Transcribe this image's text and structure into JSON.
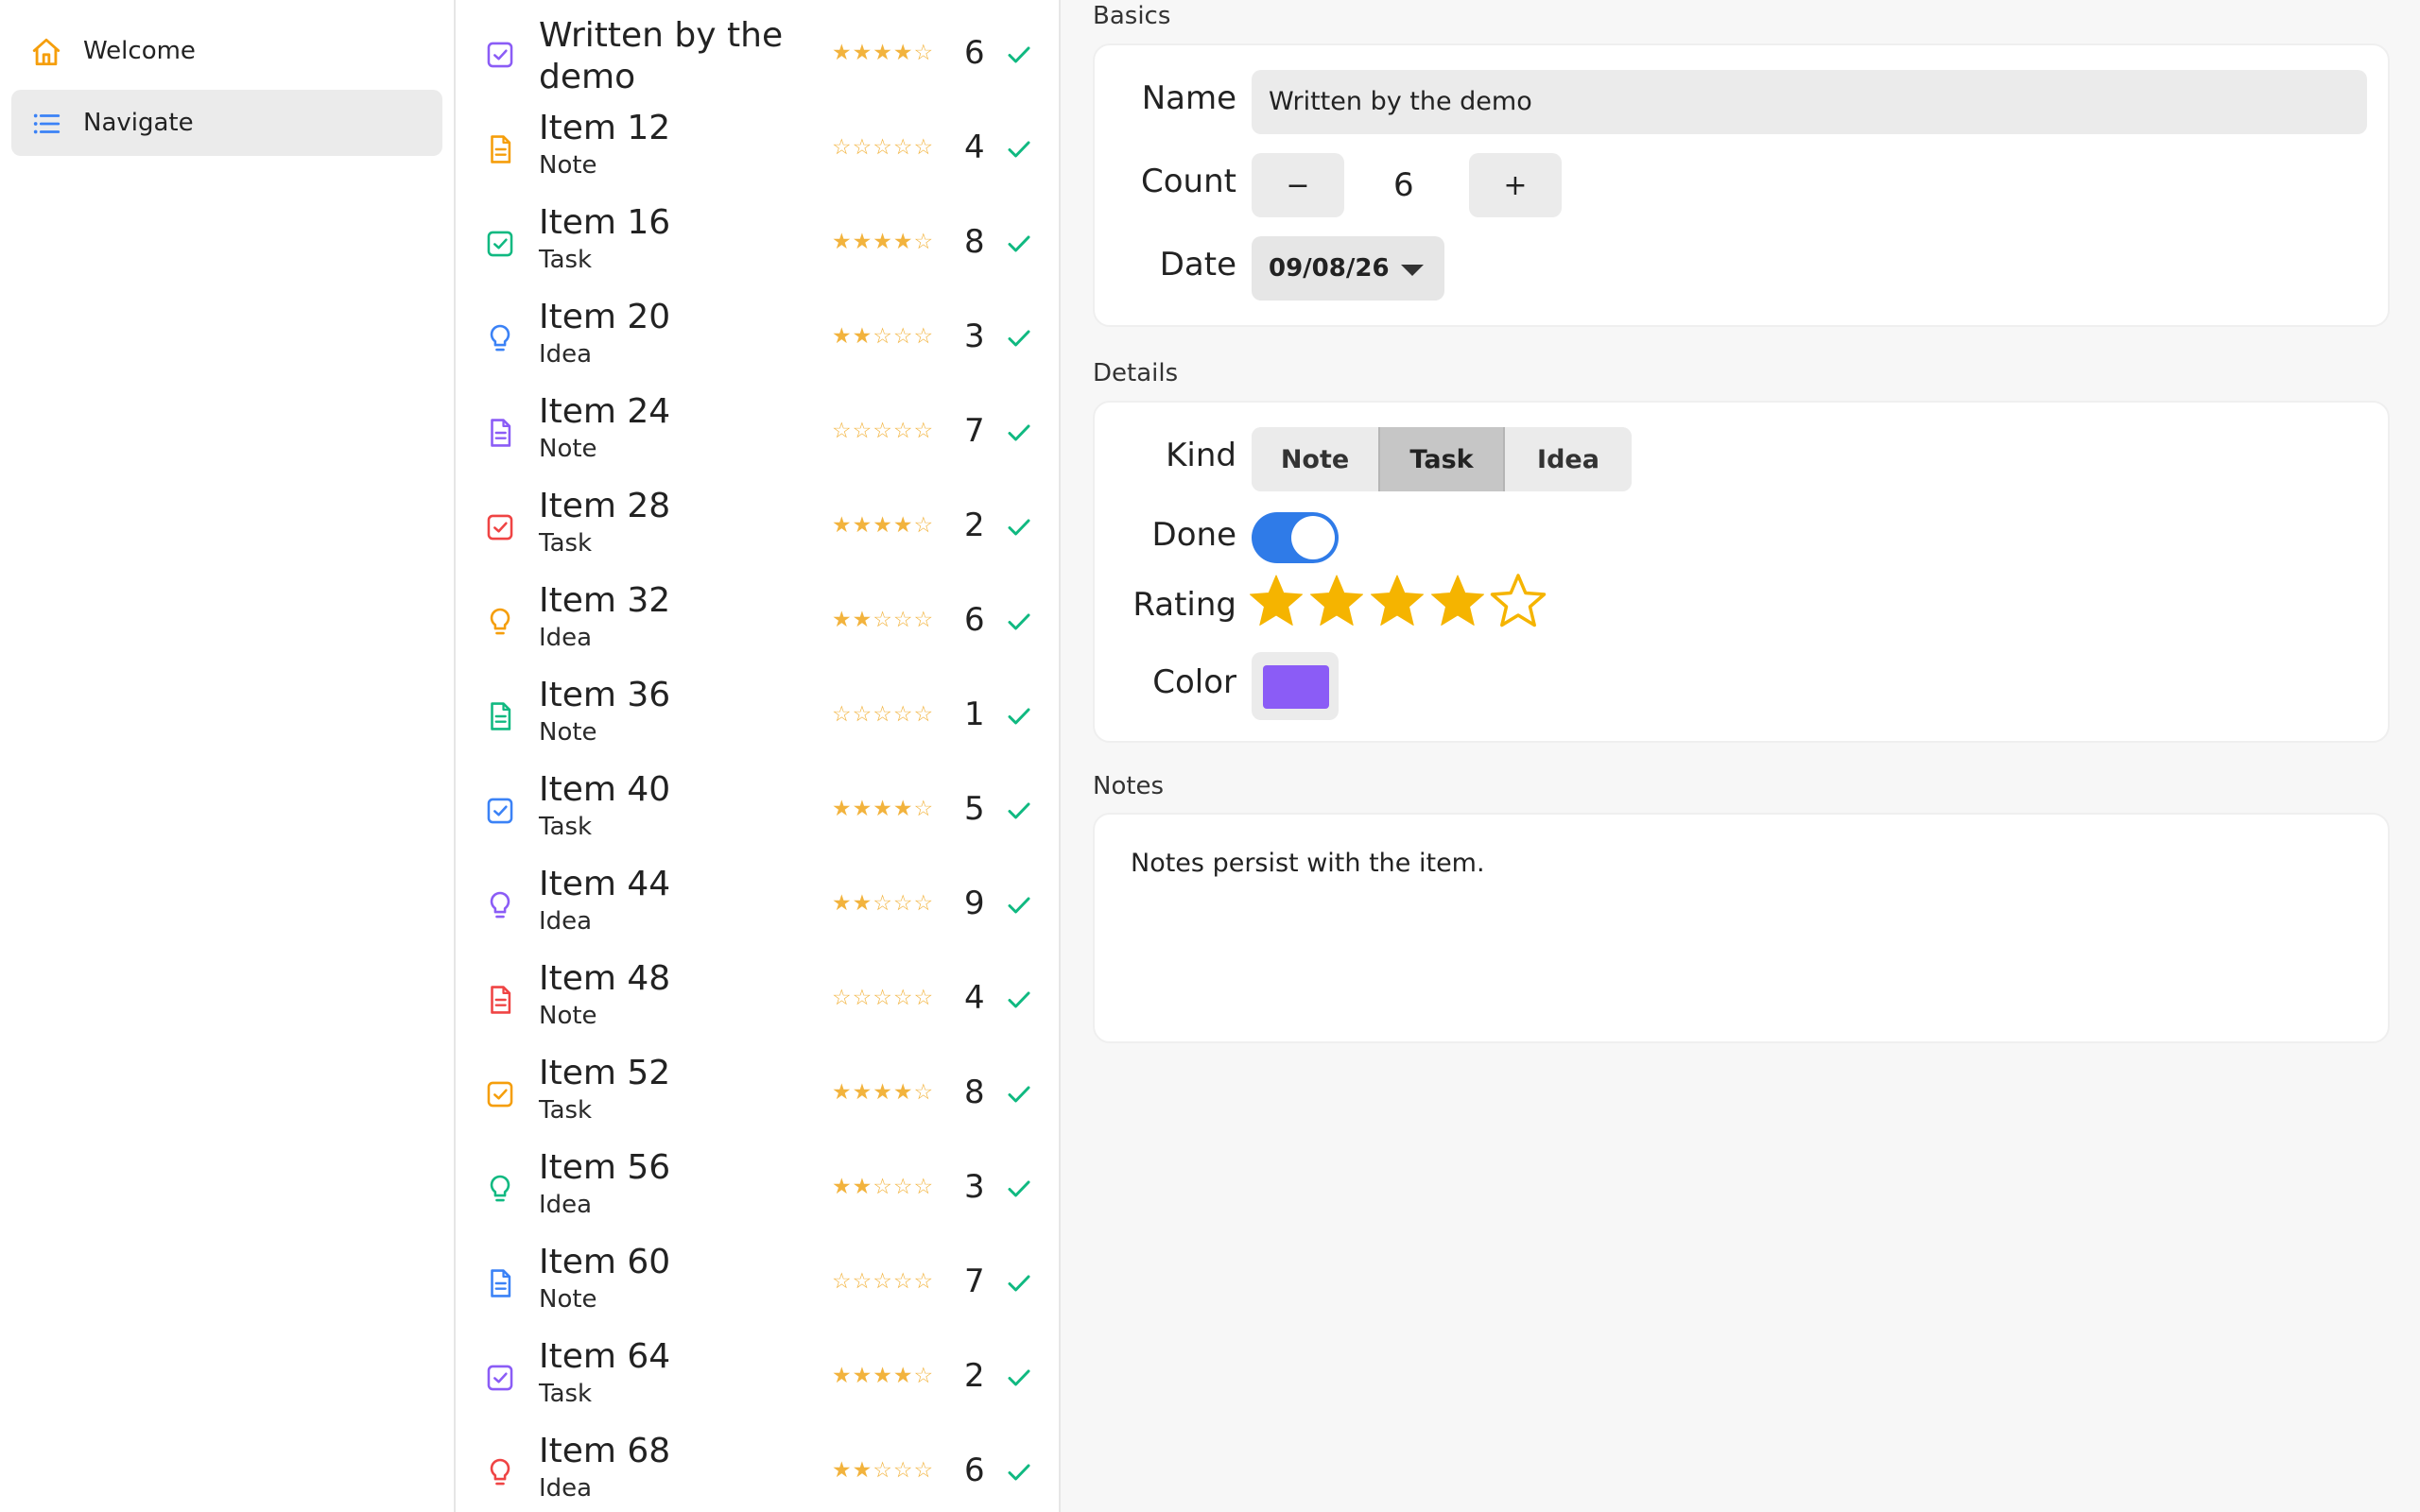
{
  "sidebar": {
    "items": [
      {
        "label": "Welcome",
        "icon": "home-icon"
      },
      {
        "label": "Navigate",
        "icon": "list-icon",
        "active": true
      }
    ]
  },
  "list": {
    "rows": [
      {
        "title": "Written by the demo",
        "subtitle": "",
        "kind": "task",
        "color": "#8b5cf6",
        "stars": "★★★★☆",
        "count": "6"
      },
      {
        "title": "Item 12",
        "subtitle": "Note",
        "kind": "note",
        "color": "#f59e0b",
        "stars": "☆☆☆☆☆",
        "count": "4"
      },
      {
        "title": "Item 16",
        "subtitle": "Task",
        "kind": "task",
        "color": "#10b981",
        "stars": "★★★★☆",
        "count": "8"
      },
      {
        "title": "Item 20",
        "subtitle": "Idea",
        "kind": "idea",
        "color": "#3b82f6",
        "stars": "★★☆☆☆",
        "count": "3"
      },
      {
        "title": "Item 24",
        "subtitle": "Note",
        "kind": "note",
        "color": "#8b5cf6",
        "stars": "☆☆☆☆☆",
        "count": "7"
      },
      {
        "title": "Item 28",
        "subtitle": "Task",
        "kind": "task",
        "color": "#ef4444",
        "stars": "★★★★☆",
        "count": "2"
      },
      {
        "title": "Item 32",
        "subtitle": "Idea",
        "kind": "idea",
        "color": "#f59e0b",
        "stars": "★★☆☆☆",
        "count": "6"
      },
      {
        "title": "Item 36",
        "subtitle": "Note",
        "kind": "note",
        "color": "#10b981",
        "stars": "☆☆☆☆☆",
        "count": "1"
      },
      {
        "title": "Item 40",
        "subtitle": "Task",
        "kind": "task",
        "color": "#3b82f6",
        "stars": "★★★★☆",
        "count": "5"
      },
      {
        "title": "Item 44",
        "subtitle": "Idea",
        "kind": "idea",
        "color": "#8b5cf6",
        "stars": "★★☆☆☆",
        "count": "9"
      },
      {
        "title": "Item 48",
        "subtitle": "Note",
        "kind": "note",
        "color": "#ef4444",
        "stars": "☆☆☆☆☆",
        "count": "4"
      },
      {
        "title": "Item 52",
        "subtitle": "Task",
        "kind": "task",
        "color": "#f59e0b",
        "stars": "★★★★☆",
        "count": "8"
      },
      {
        "title": "Item 56",
        "subtitle": "Idea",
        "kind": "idea",
        "color": "#10b981",
        "stars": "★★☆☆☆",
        "count": "3"
      },
      {
        "title": "Item 60",
        "subtitle": "Note",
        "kind": "note",
        "color": "#3b82f6",
        "stars": "☆☆☆☆☆",
        "count": "7"
      },
      {
        "title": "Item 64",
        "subtitle": "Task",
        "kind": "task",
        "color": "#8b5cf6",
        "stars": "★★★★☆",
        "count": "2"
      },
      {
        "title": "Item 68",
        "subtitle": "Idea",
        "kind": "idea",
        "color": "#ef4444",
        "stars": "★★☆☆☆",
        "count": "6"
      }
    ],
    "check_color": "#10b981"
  },
  "detail": {
    "basics": {
      "section_label": "Basics",
      "name_label": "Name",
      "name_value": "Written by the demo",
      "count_label": "Count",
      "count_value": "6",
      "minus_label": "−",
      "plus_label": "+",
      "date_label": "Date",
      "date_value": "09/08/26"
    },
    "details": {
      "section_label": "Details",
      "kind_label": "Kind",
      "kind_options": [
        "Note",
        "Task",
        "Idea"
      ],
      "kind_selected": "Task",
      "done_label": "Done",
      "done_value": true,
      "rating_label": "Rating",
      "rating_value": 4,
      "rating_max": 5,
      "color_label": "Color",
      "color_value": "#8b5cf6"
    },
    "notes": {
      "section_label": "Notes",
      "text": "Notes persist with the item."
    }
  },
  "colors": {
    "accent": "#2f7be8",
    "star": "#f5b400",
    "sidebar_active_bg": "#ebebeb"
  }
}
